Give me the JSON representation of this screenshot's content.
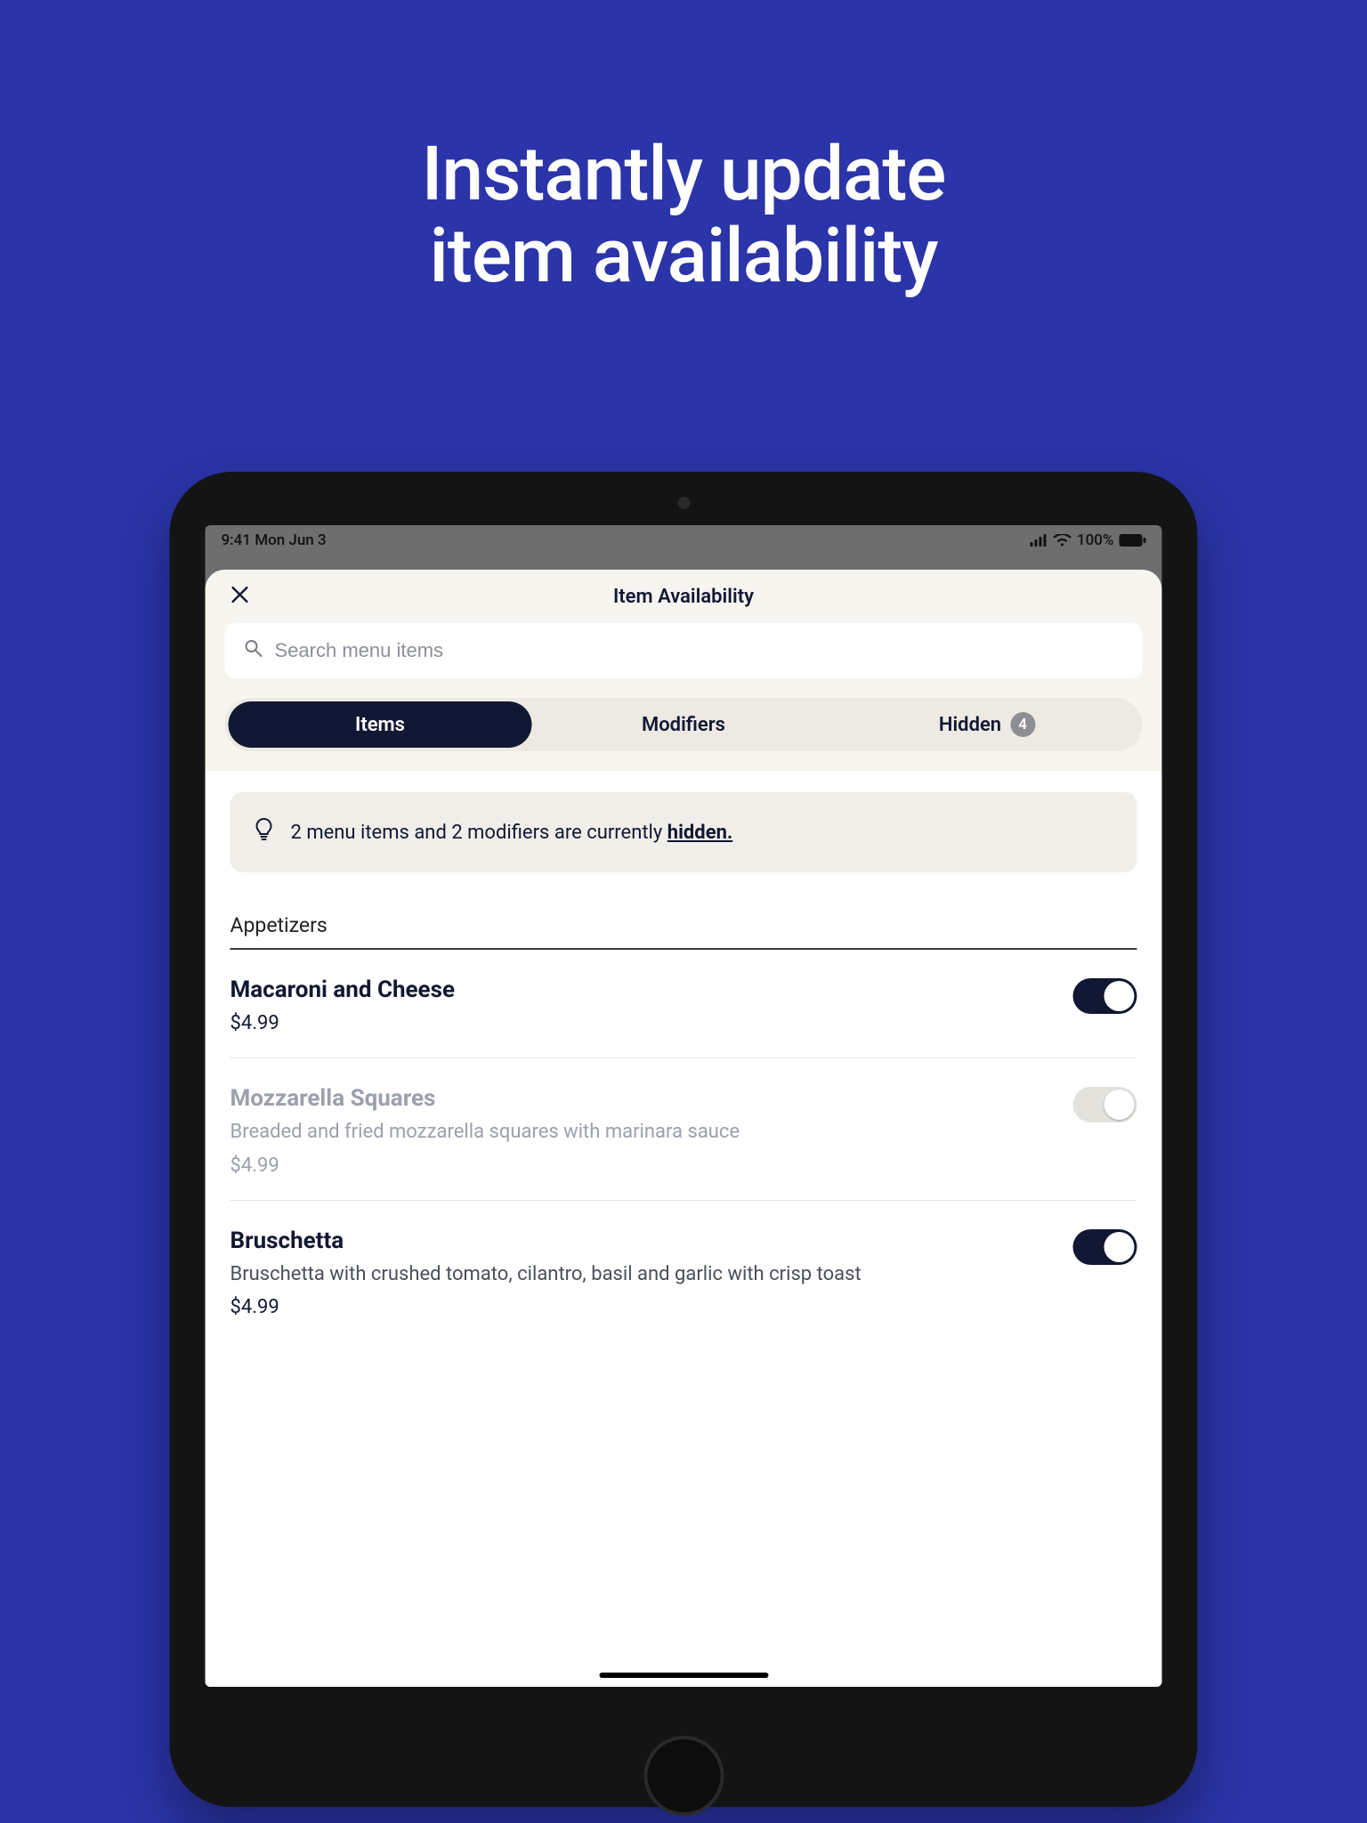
{
  "headline_line1": "Instantly update",
  "headline_line2": "item availability",
  "statusbar": {
    "time": "9:41",
    "date": "Mon Jun 3",
    "battery_pct": "100%"
  },
  "sheet": {
    "title": "Item Availability",
    "search_placeholder": "Search menu items"
  },
  "tabs": {
    "items": "Items",
    "modifiers": "Modifiers",
    "hidden": "Hidden",
    "hidden_count": "4"
  },
  "banner": {
    "text_before": "2 menu items and 2 modifiers are currently ",
    "link": "hidden."
  },
  "section": {
    "title": "Appetizers"
  },
  "menu": [
    {
      "name": "Macaroni and Cheese",
      "desc": "",
      "price": "$4.99",
      "available": true
    },
    {
      "name": "Mozzarella Squares",
      "desc": "Breaded and fried mozzarella squares with marinara sauce",
      "price": "$4.99",
      "available": false
    },
    {
      "name": "Bruschetta",
      "desc": "Bruschetta with crushed tomato, cilantro, basil and garlic with crisp toast",
      "price": "$4.99",
      "available": true
    }
  ]
}
